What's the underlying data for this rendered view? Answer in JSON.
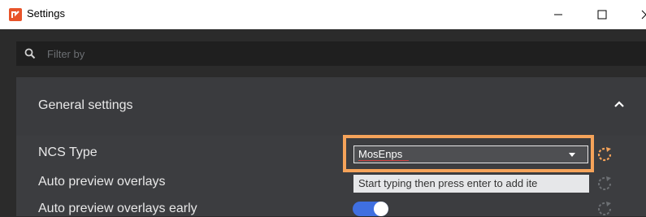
{
  "window": {
    "title": "Settings",
    "icon": "app-logo-icon",
    "controls": [
      "minimize-icon",
      "maximize-icon",
      "close-icon"
    ]
  },
  "filter": {
    "placeholder": "Filter by",
    "icon": "search-icon"
  },
  "section": {
    "title": "General settings",
    "expanded": true
  },
  "rows": [
    {
      "label": "NCS Type",
      "control": "select",
      "value": "MosEnps"
    },
    {
      "label": "Auto preview overlays",
      "control": "tag-input",
      "placeholder": "Start typing then press enter to add ite"
    },
    {
      "label": "Auto preview overlays early",
      "control": "toggle",
      "on": true
    }
  ],
  "colors": {
    "accent_highlight": "#f5a35a",
    "toggle_on": "#3f6fe0",
    "reset_active": "#f5a35a",
    "reset_inactive": "#6c6f73"
  }
}
